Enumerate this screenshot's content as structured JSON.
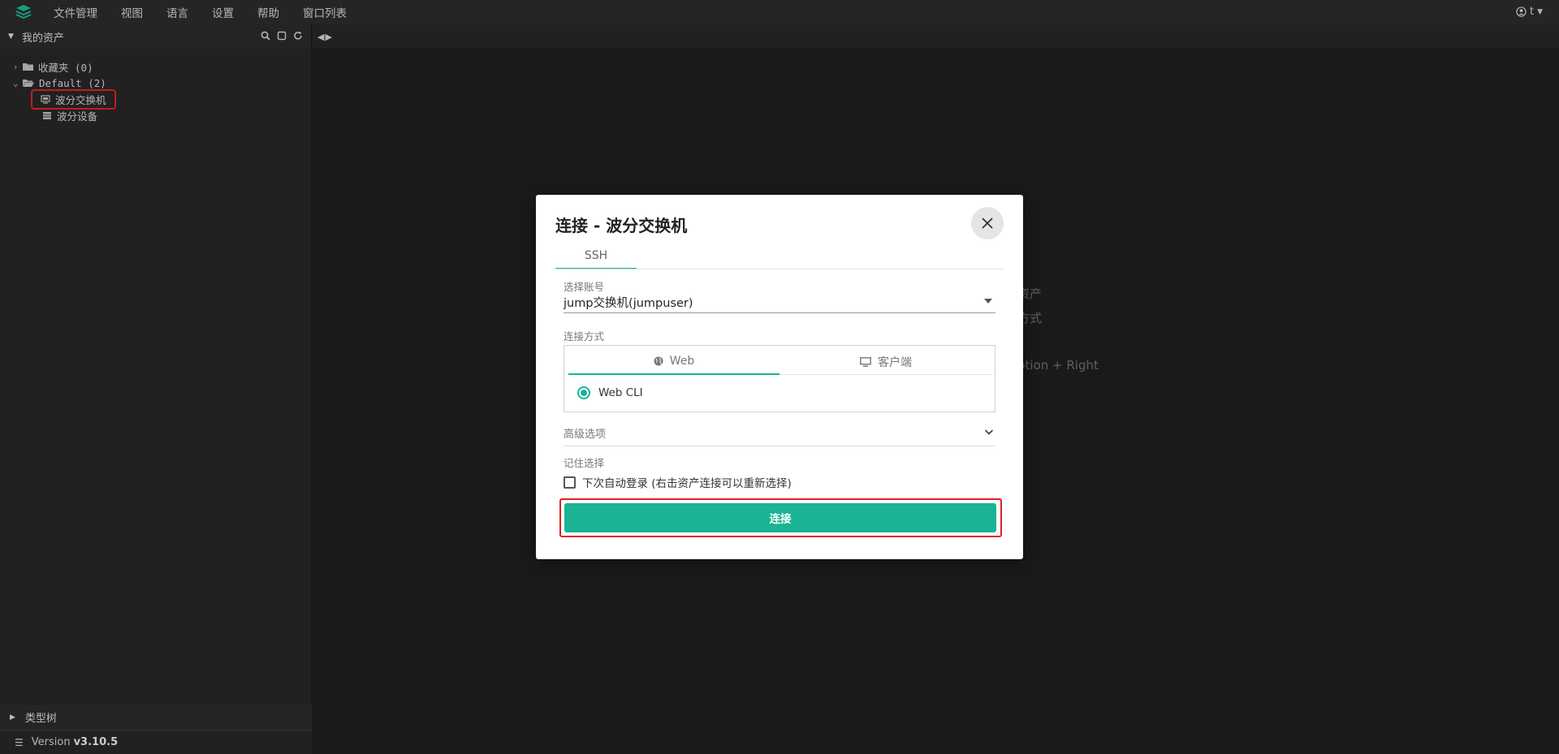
{
  "menubar": {
    "items": [
      "文件管理",
      "视图",
      "语言",
      "设置",
      "帮助",
      "窗口列表"
    ],
    "user": "t"
  },
  "sidebar": {
    "title": "我的资产",
    "tree": [
      {
        "label": "收藏夹 (0)"
      },
      {
        "label": "Default (2)"
      },
      {
        "label": "波分交换机"
      },
      {
        "label": "波分设备"
      }
    ],
    "bottom_section": "类型树",
    "version_prefix": "Version",
    "version": "v3.10.5"
  },
  "background_hints": {
    "line1": "资产",
    "line2": "方式",
    "line3": "ption + Right"
  },
  "modal": {
    "title": "连接 - 波分交换机",
    "tab": "SSH",
    "account_label": "选择账号",
    "account_value": "jump交换机(jumpuser)",
    "method_label": "连接方式",
    "method_tabs": {
      "web": "Web",
      "client": "客户端"
    },
    "method_option": "Web CLI",
    "advanced_label": "高级选项",
    "remember_label": "记住选择",
    "auto_login_label": "下次自动登录 (右击资产连接可以重新选择)",
    "connect_button": "连接"
  },
  "colors": {
    "accent": "#1ab394",
    "highlight": "#e02020"
  }
}
